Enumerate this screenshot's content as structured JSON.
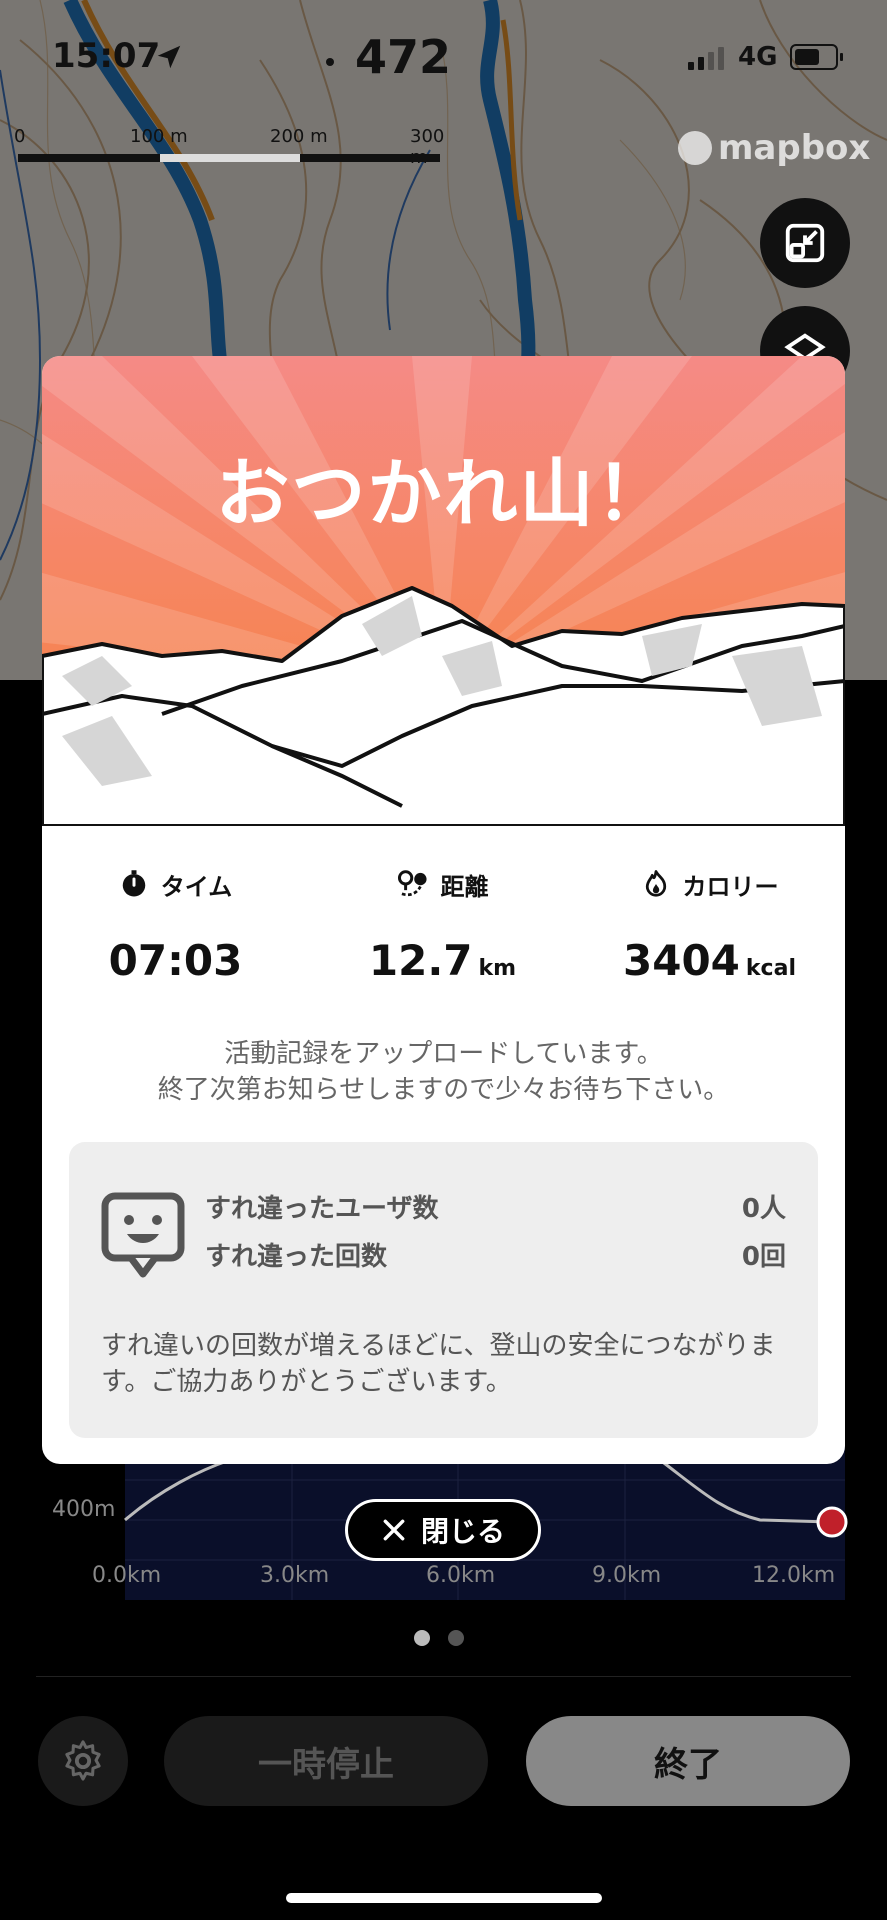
{
  "status_bar": {
    "time": "15:07",
    "altitude": "472",
    "network": "4G"
  },
  "map": {
    "scale_labels": [
      "0",
      "100 m",
      "200 m",
      "300 m"
    ],
    "attribution": "mapbox"
  },
  "modal": {
    "title": "おつかれ山！",
    "stats": [
      {
        "label": "タイム",
        "value": "07:03",
        "unit": "",
        "icon": "timer-icon"
      },
      {
        "label": "距離",
        "value": "12.7",
        "unit": "km",
        "icon": "route-pin-icon"
      },
      {
        "label": "カロリー",
        "value": "3404",
        "unit": "kcal",
        "icon": "flame-icon"
      }
    ],
    "upload_message_line1": "活動記録をアップロードしています。",
    "upload_message_line2": "終了次第お知らせしますので少々お待ち下さい。",
    "passing": {
      "users_label": "すれ違ったユーザ数",
      "users_value": "0人",
      "count_label": "すれ違った回数",
      "count_value": "0回",
      "note": "すれ違いの回数が増えるほどに、登山の安全につながります。ご協力ありがとうございます。"
    },
    "close_label": "閉じる"
  },
  "elevation_chart": {
    "y_label": "400m",
    "x_labels": [
      "0.0km",
      "3.0km",
      "6.0km",
      "9.0km",
      "12.0km"
    ]
  },
  "pager": {
    "current": 1,
    "total": 2
  },
  "controls": {
    "pause_label": "一時停止",
    "end_label": "終了"
  },
  "colors": {
    "hero_top": "#f58a86",
    "hero_bottom": "#f7813a",
    "track_blue": "#1f6fb5",
    "end_button": "#888888"
  }
}
